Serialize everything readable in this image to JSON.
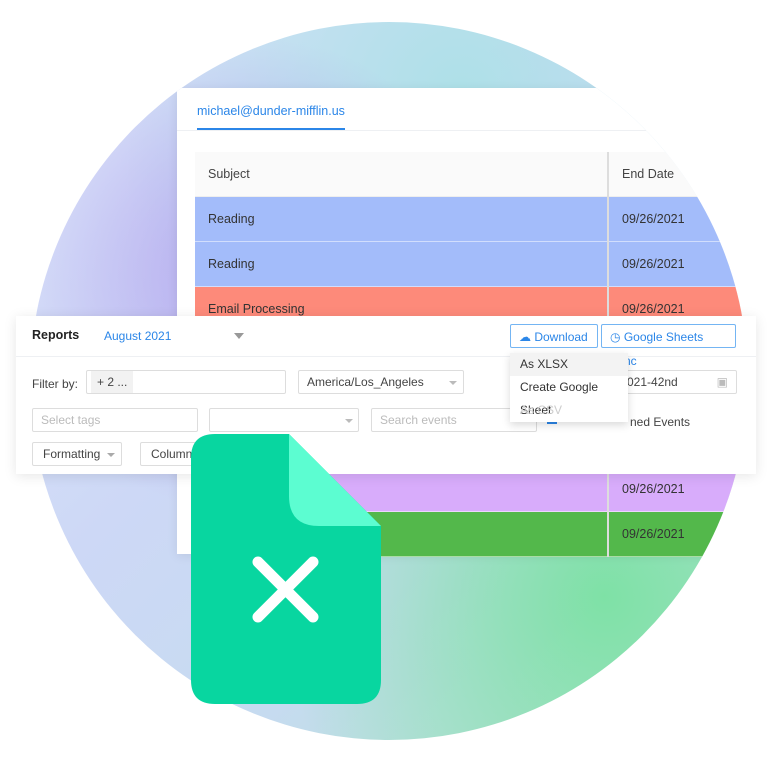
{
  "account_tab": "michael@dunder-mifflin.us",
  "table": {
    "headers": [
      "Subject",
      "End Date"
    ],
    "rows": [
      {
        "subject": "Reading",
        "end_date": "09/26/2021",
        "color": "#a3bcfa"
      },
      {
        "subject": "Reading",
        "end_date": "09/26/2021",
        "color": "#a3bcfa"
      },
      {
        "subject": "Email Processing",
        "end_date": "09/26/2021",
        "color": "#fd8a7a"
      },
      {
        "subject": "",
        "end_date": "09/26/2021",
        "color": "#d8acfb"
      },
      {
        "subject": "",
        "end_date": "09/26/2021",
        "color": "#53b84b"
      }
    ]
  },
  "reports": {
    "title": "Reports",
    "month": "August 2021",
    "download_label": "Download",
    "sync_label": "Google Sheets Sync",
    "filter_label": "Filter by:",
    "filter_chip": "+ 2 ...",
    "timezone": "America/Los_Angeles",
    "date_range_partial": "021-42nd",
    "tags_placeholder": "Select tags",
    "search_placeholder": "Search events",
    "events_label_partial": "ned Events",
    "formatting_label": "Formatting",
    "columns_label": "Columns"
  },
  "download_menu": {
    "items": [
      {
        "label": "As XLSX",
        "state": "highlighted"
      },
      {
        "label": "Create Google Sheet",
        "state": "normal"
      },
      {
        "label": "As CSV",
        "state": "disabled"
      }
    ]
  },
  "colors": {
    "accent": "#2b86e8",
    "file_icon": "#08d6a0",
    "file_fold": "#5cfdd1"
  }
}
